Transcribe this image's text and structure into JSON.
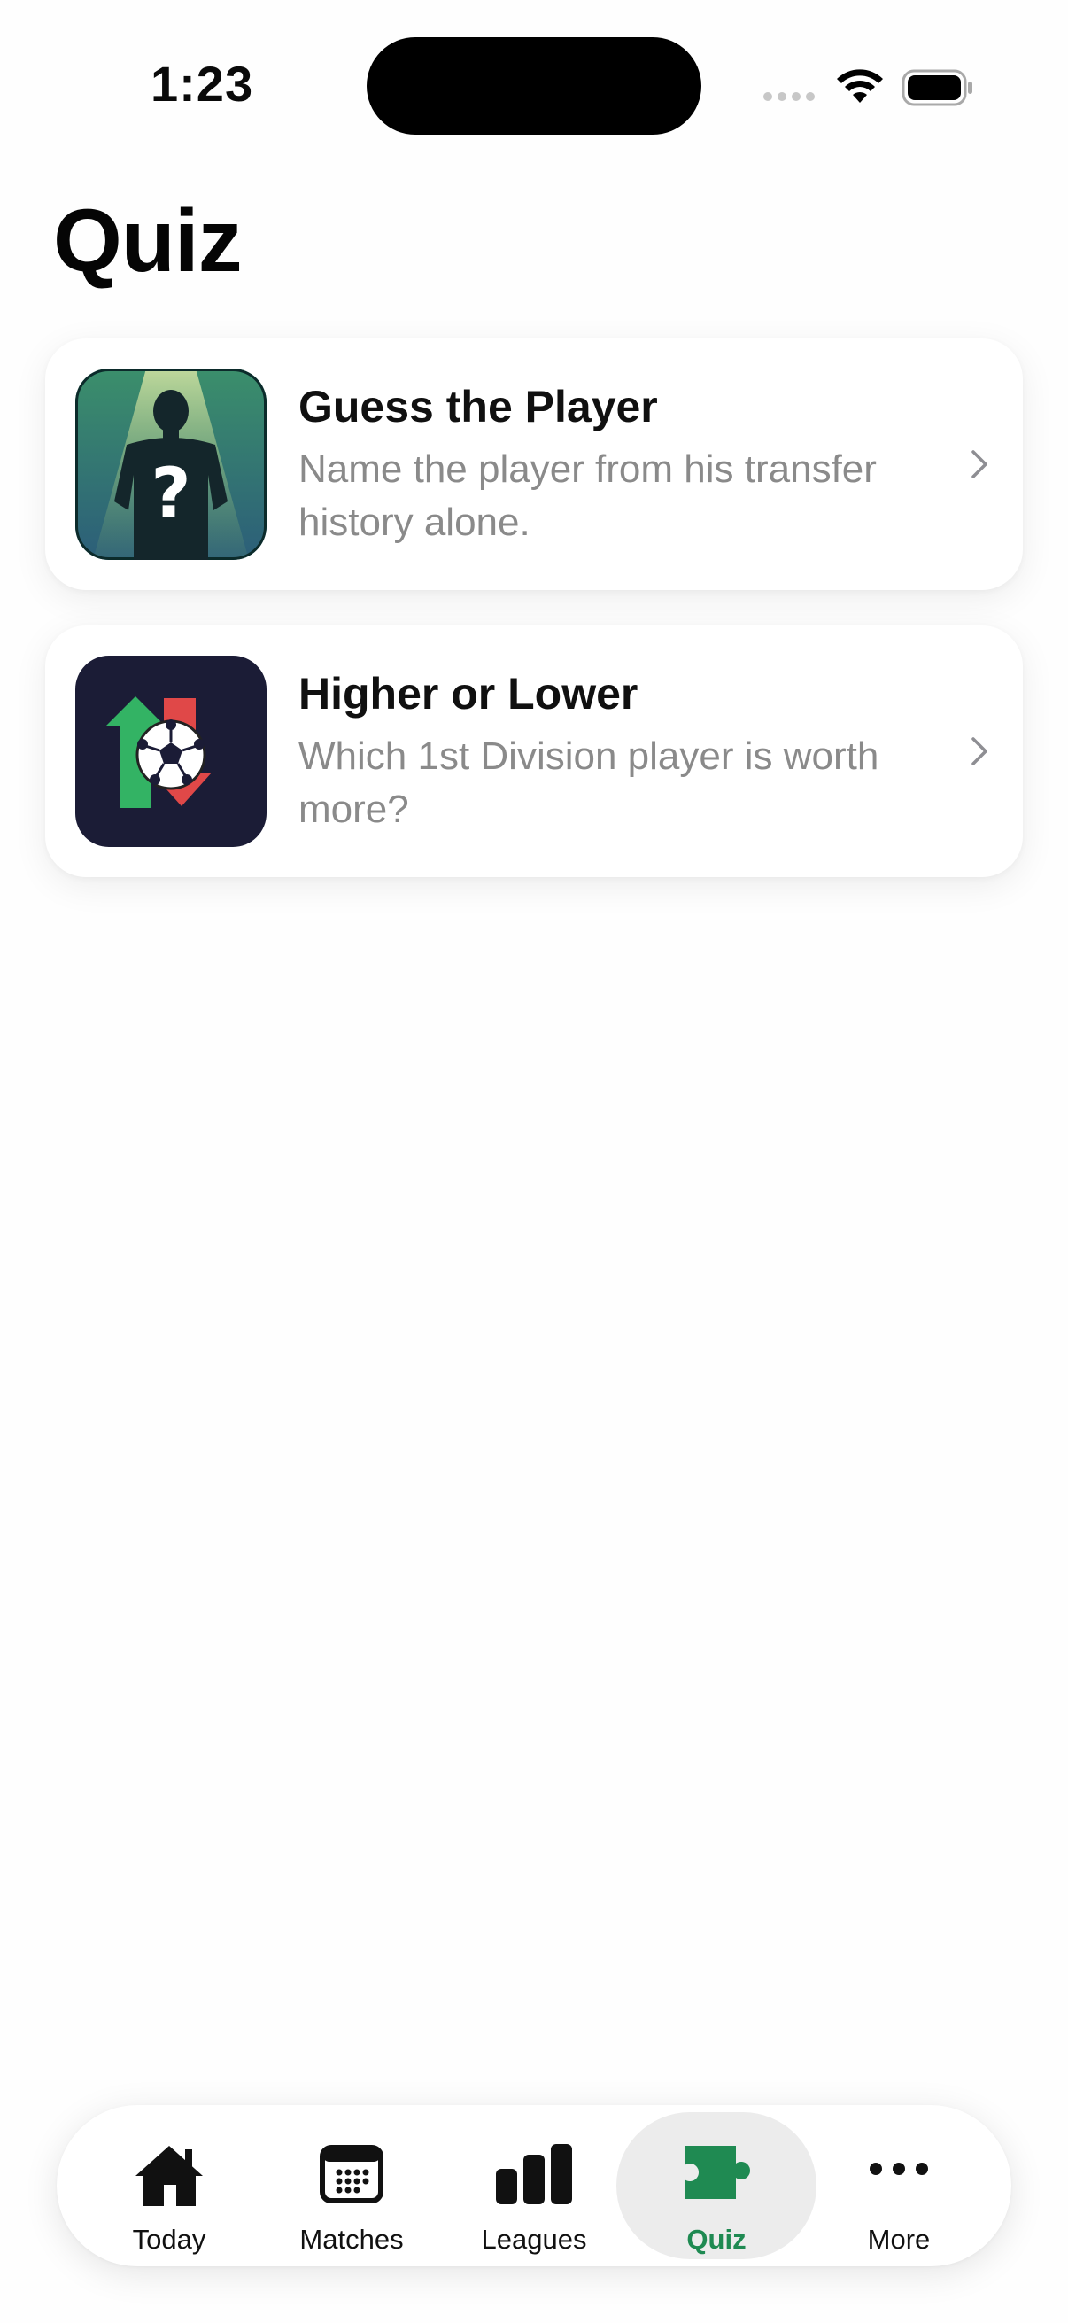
{
  "status_bar": {
    "time": "1:23"
  },
  "page": {
    "title": "Quiz"
  },
  "quizzes": [
    {
      "title": "Guess the Player",
      "subtitle": "Name the player from his transfer history alone."
    },
    {
      "title": "Higher or Lower",
      "subtitle": "Which 1st Division player is worth more?"
    }
  ],
  "tab_bar": {
    "active": "Quiz",
    "accent_color": "#1f8a52",
    "items": [
      {
        "label": "Today",
        "icon": "house-icon"
      },
      {
        "label": "Matches",
        "icon": "calendar-icon"
      },
      {
        "label": "Leagues",
        "icon": "bar-chart-icon"
      },
      {
        "label": "Quiz",
        "icon": "puzzle-piece-icon"
      },
      {
        "label": "More",
        "icon": "ellipsis-icon"
      }
    ]
  }
}
